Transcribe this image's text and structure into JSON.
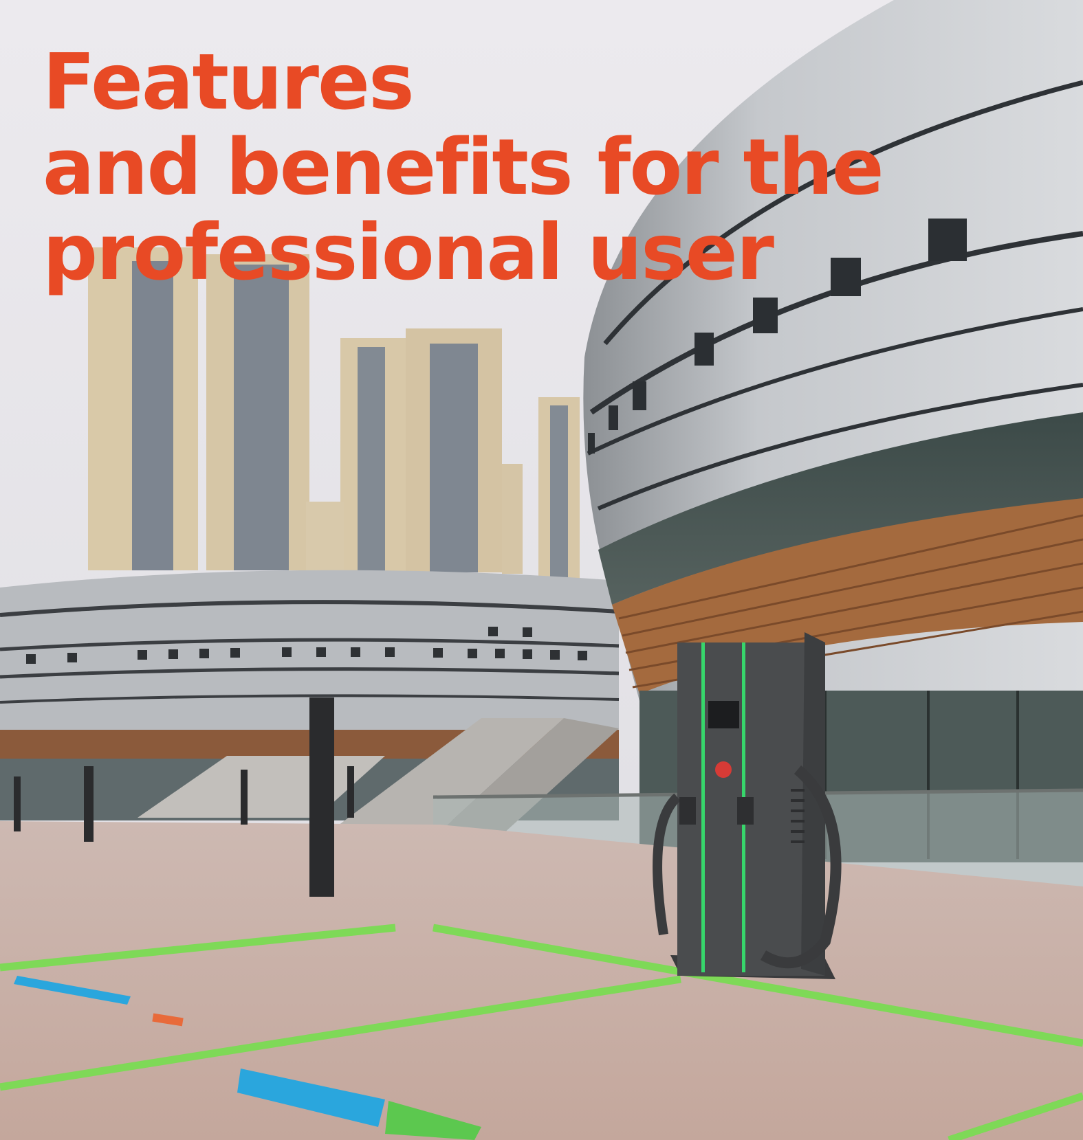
{
  "headline": {
    "lines": [
      "Features",
      "and benefits for the",
      "professional user"
    ],
    "color": "#e84a25"
  },
  "scene": {
    "sky_color": "#e7e6ea",
    "pavement_color": "#c9aea4",
    "facade_color": "#b9bcc0",
    "parking_line_color": "#7ed957",
    "charger_color": "#4a4c4e",
    "charger_accent_color": "#37d66b",
    "ground_logo_color": "#2aa6dd"
  }
}
